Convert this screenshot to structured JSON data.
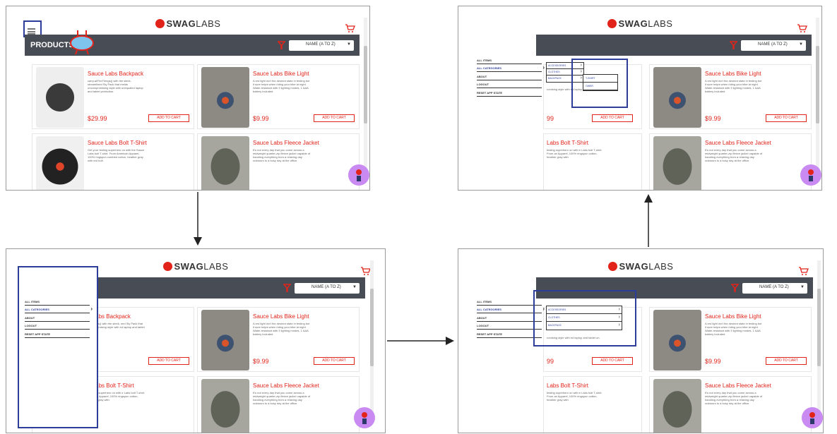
{
  "logo": {
    "brand": "SWAG",
    "brand_light": "LABS"
  },
  "header": {
    "title": "PRODUCTS"
  },
  "sort": {
    "selected": "NAME (A TO Z)"
  },
  "add_to_cart_label": "ADD TO CART",
  "products": [
    {
      "name": "Sauce Labs Backpack",
      "description": "carry.allTheThings() with the sleek, streamlined Sly Pack that melds uncompromising style with unequaled laptop and tablet protection.",
      "price": "$29.99",
      "image": "backpack-image"
    },
    {
      "name": "Sauce Labs Bike Light",
      "description": "A red light isn't the desired state in testing but it sure helps when riding your bike at night. Water-resistant with 3 lighting modes, 1 AAA battery included.",
      "price": "$9.99",
      "image": "bike-light-image"
    },
    {
      "name": "Sauce Labs Bolt T-Shirt",
      "description": "Get your testing superhero on with the Sauce Labs bolt T-shirt. From American Apparel, 100% ringspun combed cotton, heather gray with red bolt.",
      "price": "",
      "image": "tshirt-image"
    },
    {
      "name": "Sauce Labs Fleece Jacket",
      "description": "It's not every day that you come across a midweight quarter-zip fleece jacket capable of handling everything from a relaxing day outdoors to a busy day at the office.",
      "price": "",
      "image": "jacket-image"
    }
  ],
  "partial": {
    "backpack_name": "e Labs Backpack",
    "backpack_desc": "heTh!ngs() with the sleek, ned Sly Pack that melds romising style with ed laptop and tablet on.",
    "backpack_price": "99",
    "tshirt_name": "e Labs Bolt T-Shirt",
    "tshirt_desc": "r testing superhero on with e Labs bolt T-shirt. From an Apparel, 100% ringspun cotton, heather gray with",
    "p3_backpack_desc": "romising style with ed laptop and tablet on.",
    "p3_backpack_price": "99",
    "p3_tshirt_name": "Labs Bolt T-Shirt",
    "p3_tshirt_desc": "testing superhero on with e Labs bolt T-shirt. From an Apparel, 100% ringspun cotton, heather gray with",
    "p4_backpack_desc": "romising style with ed laptop and tablet on.",
    "p4_tshirt_name": "Labs Bolt T-Shirt",
    "p4_tshirt_desc": "testing superhero on with e Labs bolt T-shirt. From an Apparel, 100% ringspun cotton, heather gray with"
  },
  "sidebar": {
    "items": [
      {
        "label": "ALL ITEMS"
      },
      {
        "label": "ALL CATEGORIES"
      },
      {
        "label": "ABOUT"
      },
      {
        "label": "LOGOUT"
      },
      {
        "label": "RESET APP STATE"
      }
    ]
  },
  "categories": [
    "ACCESSORIES",
    "CLOTHES",
    "BACKPACK"
  ],
  "clothes_sub": [
    "T-SHIRT",
    "OWER"
  ],
  "colors": {
    "accent": "#e2231a",
    "header_bar": "#474c55",
    "annotation": "#2d3e9a",
    "robot": "#c98bf2"
  }
}
